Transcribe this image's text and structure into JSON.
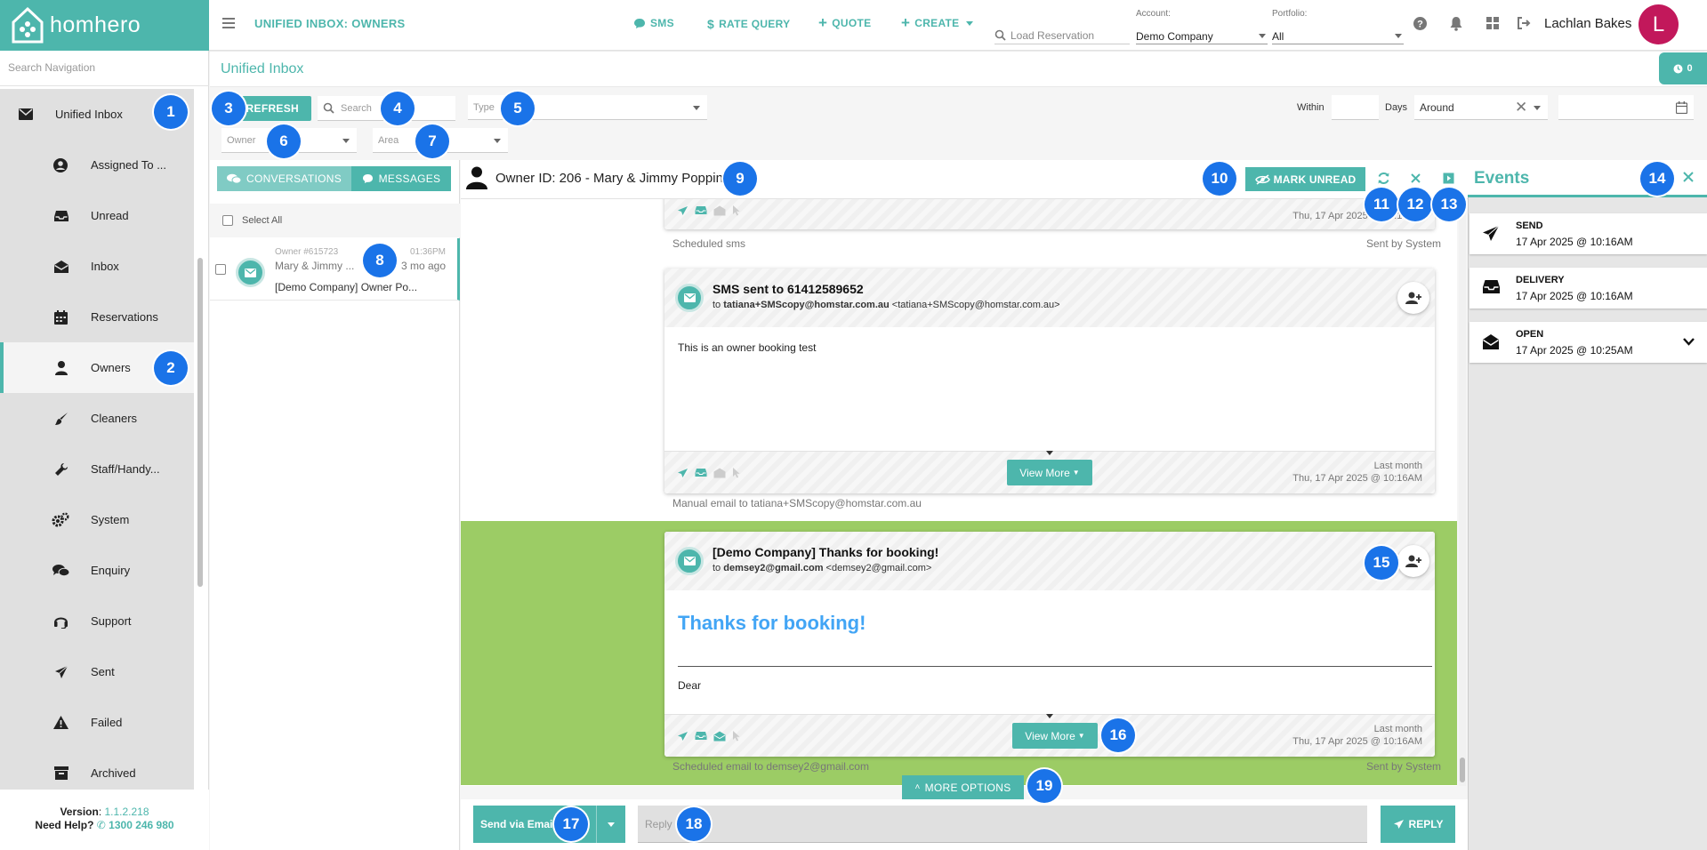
{
  "header": {
    "brand": "homhero",
    "page_heading": "UNIFIED INBOX: OWNERS",
    "sms_label": "SMS",
    "rate_query_label": "RATE QUERY",
    "quote_label": "QUOTE",
    "create_label": "CREATE",
    "load_reservation_placeholder": "Load Reservation",
    "account_label": "Account:",
    "account_value": "Demo Company",
    "portfolio_label": "Portfolio:",
    "portfolio_value": "All",
    "user_name": "Lachlan Bakes",
    "avatar_initial": "L",
    "icons": [
      "menu-icon",
      "help-icon",
      "bell-icon",
      "apps-grid-icon",
      "logout-icon"
    ]
  },
  "sidebar": {
    "search_placeholder": "Search Navigation",
    "items": [
      {
        "label": "Unified Inbox",
        "icon": "envelope-icon"
      },
      {
        "label": "Assigned To ...",
        "icon": "account-circle-icon"
      },
      {
        "label": "Unread",
        "icon": "inbox-tray-icon"
      },
      {
        "label": "Inbox",
        "icon": "open-envelope-icon"
      },
      {
        "label": "Reservations",
        "icon": "calendar-icon"
      },
      {
        "label": "Owners",
        "icon": "person-icon",
        "active": true
      },
      {
        "label": "Cleaners",
        "icon": "brush-icon"
      },
      {
        "label": "Staff/Handy...",
        "icon": "wrench-icon"
      },
      {
        "label": "System",
        "icon": "gears-icon"
      },
      {
        "label": "Enquiry",
        "icon": "chat-bubbles-icon"
      },
      {
        "label": "Support",
        "icon": "headset-icon"
      },
      {
        "label": "Sent",
        "icon": "paper-plane-icon"
      },
      {
        "label": "Failed",
        "icon": "warning-icon"
      },
      {
        "label": "Archived",
        "icon": "archive-box-icon"
      }
    ],
    "version_label": "Version",
    "version_value": "1.1.2.218",
    "help_label": "Need Help?",
    "help_phone": "1300 246 980"
  },
  "inbox": {
    "title": "Unified Inbox",
    "count": "0",
    "refresh_label": "REFRESH",
    "search_placeholder": "Search",
    "type_placeholder": "Type",
    "owner_placeholder": "Owner",
    "area_placeholder": "Area",
    "within_label": "Within",
    "days_label": "Days",
    "around_value": "Around"
  },
  "list": {
    "tab_conversations": "CONVERSATIONS",
    "tab_messages": "MESSAGES",
    "select_all_label": "Select All",
    "conversations": [
      {
        "id": "Owner #615723",
        "time": "01:36PM",
        "name": "Mary & Jimmy ...",
        "ago": "3 mo ago",
        "subject": "[Demo Company] Owner Po..."
      }
    ]
  },
  "thread": {
    "title": "Owner ID: 206 - Mary & Jimmy Poppins",
    "mark_unread_label": "MARK UNREAD",
    "messages": [
      {
        "timestamp": "Thu, 17 Apr 2025 @ 10:16AM",
        "caption": "Scheduled sms",
        "sent_by": "Sent by System"
      },
      {
        "subject": "SMS sent to 61412589652",
        "to_prefix": "to",
        "to_name": "tatiana+SMScopy@homstar.com.au",
        "to_addr": "<tatiana+SMScopy@homstar.com.au>",
        "body": "This is an owner booking test",
        "view_more": "View More",
        "relative": "Last month",
        "timestamp": "Thu, 17 Apr 2025 @ 10:16AM",
        "caption": "Manual email to tatiana+SMScopy@homstar.com.au"
      },
      {
        "subject": "[Demo Company] Thanks for booking!",
        "to_prefix": "to",
        "to_name": "demsey2@gmail.com",
        "to_addr": "<demsey2@gmail.com>",
        "heading": "Thanks for booking!",
        "body": "Dear",
        "view_more": "View More",
        "relative": "Last month",
        "timestamp": "Thu, 17 Apr 2025 @ 10:16AM",
        "caption": "Scheduled email to demsey2@gmail.com",
        "sent_by": "Sent by System"
      }
    ],
    "more_options_label": "MORE OPTIONS",
    "send_via_label": "Send via Email",
    "reply_placeholder": "Reply",
    "reply_button": "REPLY"
  },
  "events": {
    "title": "Events",
    "items": [
      {
        "name": "SEND",
        "time": "17 Apr 2025 @ 10:16AM",
        "icon": "paper-plane-icon"
      },
      {
        "name": "DELIVERY",
        "time": "17 Apr 2025 @ 10:16AM",
        "icon": "inbox-tray-icon"
      },
      {
        "name": "OPEN",
        "time": "17 Apr 2025 @ 10:25AM",
        "icon": "open-envelope-icon"
      }
    ]
  },
  "callouts": [
    "1",
    "2",
    "3",
    "4",
    "5",
    "6",
    "7",
    "8",
    "9",
    "10",
    "11",
    "12",
    "13",
    "14",
    "15",
    "16",
    "17",
    "18",
    "19"
  ],
  "colors": {
    "accent": "#4db6ac",
    "highlight_band": "#9ccc65",
    "heading_blue": "#42a5f5",
    "callout": "#1a73e8",
    "avatar": "#c2185b"
  }
}
